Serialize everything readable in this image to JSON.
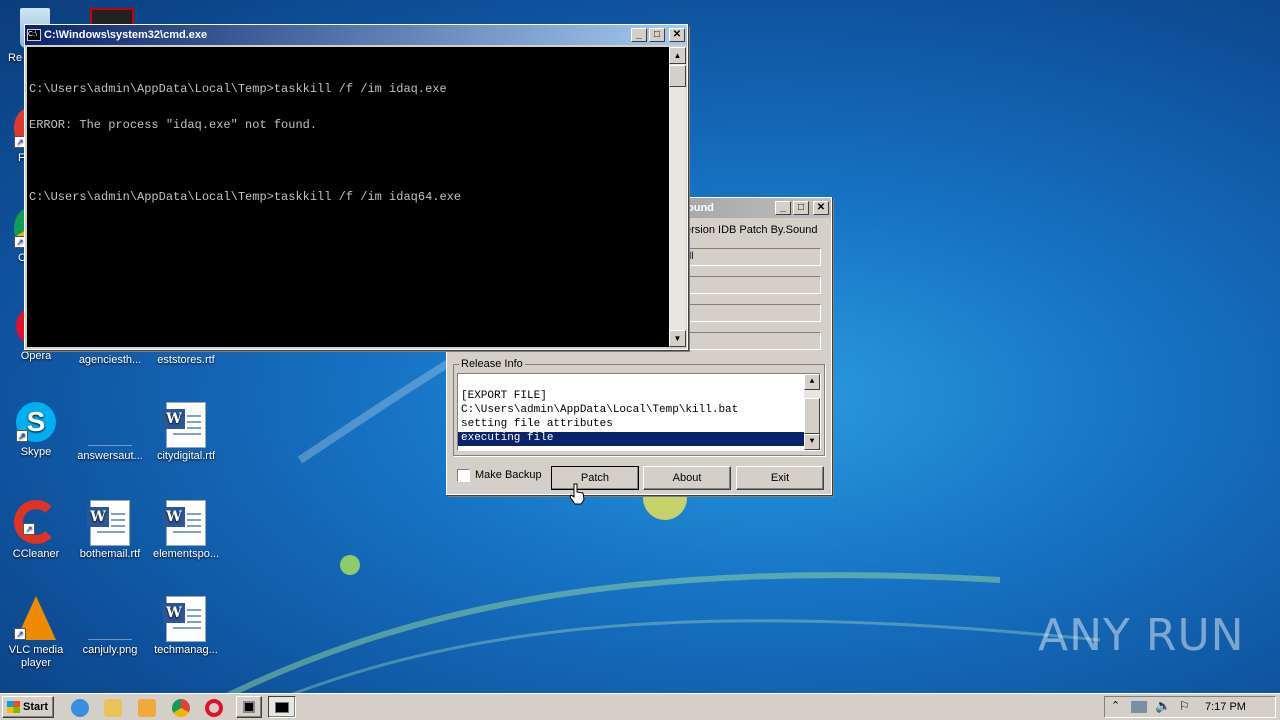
{
  "desktop": {
    "icons": [
      {
        "label": "Re",
        "kind": "recycle"
      },
      {
        "label": "F",
        "kind": "app"
      },
      {
        "label": "C",
        "kind": "app"
      },
      {
        "label": "Opera",
        "kind": "opera"
      },
      {
        "label": "agenciesth...",
        "kind": "blank"
      },
      {
        "label": "eststores.rtf",
        "kind": "word"
      },
      {
        "label": "Skype",
        "kind": "skype"
      },
      {
        "label": "answersaut...",
        "kind": "blank"
      },
      {
        "label": "citydigital.rtf",
        "kind": "word"
      },
      {
        "label": "CCleaner",
        "kind": "ccleaner"
      },
      {
        "label": "bothemail.rtf",
        "kind": "word"
      },
      {
        "label": "elementspo...",
        "kind": "word"
      },
      {
        "label": "VLC media player",
        "kind": "vlc"
      },
      {
        "label": "canjuly.png",
        "kind": "blank"
      },
      {
        "label": "techmanag...",
        "kind": "word"
      }
    ],
    "watermark": "ANY RUN"
  },
  "cmd": {
    "title": "C:\\Windows\\system32\\cmd.exe",
    "lines": [
      "C:\\Users\\admin\\AppData\\Local\\Temp>taskkill /f /im idaq.exe",
      "ERROR: The process \"idaq.exe\" not found.",
      "",
      "C:\\Users\\admin\\AppData\\Local\\Temp>taskkill /f /im idaq64.exe"
    ]
  },
  "patcher": {
    "title": "ound",
    "subtitle": "ersion IDB Patch By.Sound",
    "fields": [
      "ll",
      "",
      "",
      ""
    ],
    "group_label": "Release Info",
    "log": [
      "[EXPORT FILE]",
      "C:\\Users\\admin\\AppData\\Local\\Temp\\kill.bat",
      "setting file attributes",
      "executing file"
    ],
    "selected_index": 3,
    "make_backup_label": "Make Backup",
    "make_backup_checked": false,
    "patch_label": "Patch",
    "about_label": "About",
    "exit_label": "Exit"
  },
  "taskbar": {
    "start_label": "Start",
    "clock": "7:17 PM"
  },
  "colors": {
    "title_active": "#0a246a",
    "selection": "#0a246a",
    "console_bg": "#000000",
    "console_fg": "#c0c0c0"
  }
}
